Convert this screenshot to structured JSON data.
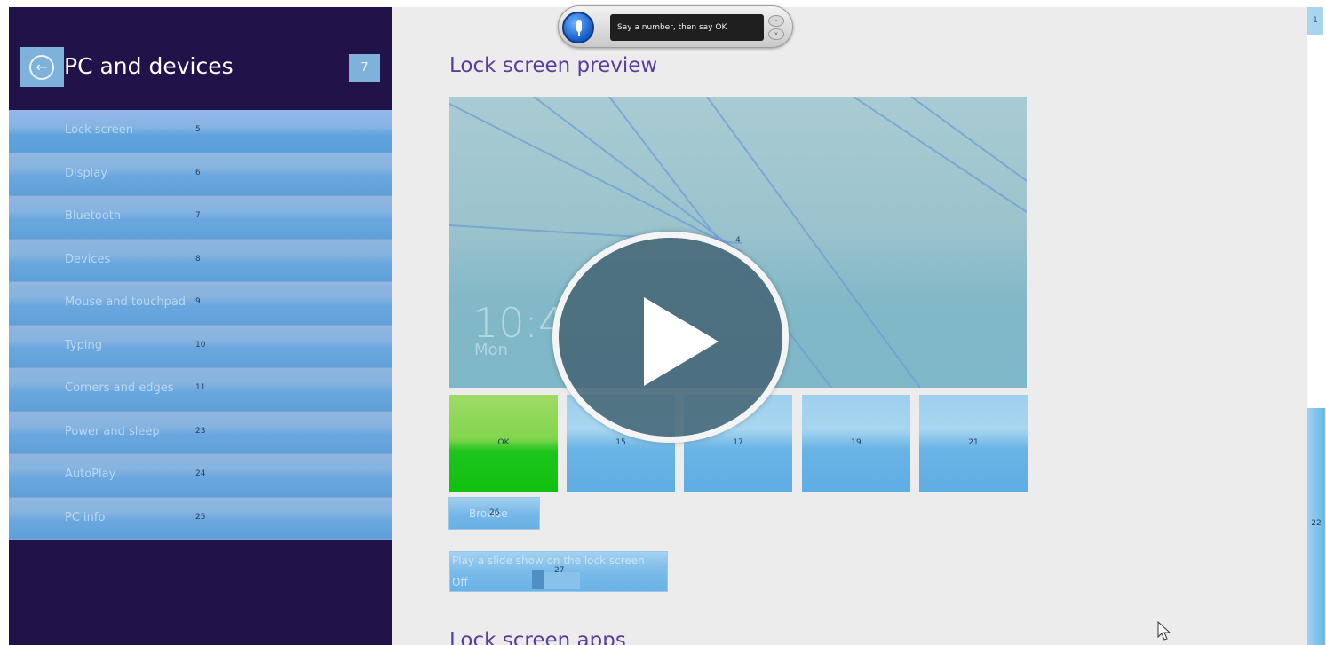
{
  "sidebar": {
    "title": "PC and devices",
    "back_icon": "back-arrow-icon",
    "badge": "7",
    "items": [
      {
        "label": "Lock screen",
        "num": "5"
      },
      {
        "label": "Display",
        "num": "6"
      },
      {
        "label": "Bluetooth",
        "num": "7"
      },
      {
        "label": "Devices",
        "num": "8"
      },
      {
        "label": "Mouse and touchpad",
        "num": "9"
      },
      {
        "label": "Typing",
        "num": "10"
      },
      {
        "label": "Corners and edges",
        "num": "11"
      },
      {
        "label": "Power and sleep",
        "num": "23"
      },
      {
        "label": "AutoPlay",
        "num": "24"
      },
      {
        "label": "PC info",
        "num": "25"
      }
    ]
  },
  "main": {
    "section_title": "Lock screen preview",
    "preview": {
      "clock": "10:4",
      "date": "Mon",
      "num": "4"
    },
    "thumbnails": [
      {
        "label": "OK"
      },
      {
        "label": "15"
      },
      {
        "label": "17"
      },
      {
        "label": "19"
      },
      {
        "label": "21"
      }
    ],
    "browse": {
      "label": "Browse",
      "num": "26"
    },
    "slideshow": {
      "label": "Play a slide show on the lock screen",
      "state": "Off",
      "num": "27"
    },
    "section_title_2": "Lock screen apps"
  },
  "scroll": {
    "top_num": "1",
    "bar_num": "22"
  },
  "speech": {
    "prompt": "Say a number, then say OK"
  },
  "colors": {
    "sidebar_bg": "#22124a",
    "accent_title": "#5a3e9c",
    "ok_green": "#10c010",
    "tile_blue": "#6ab4e6"
  }
}
